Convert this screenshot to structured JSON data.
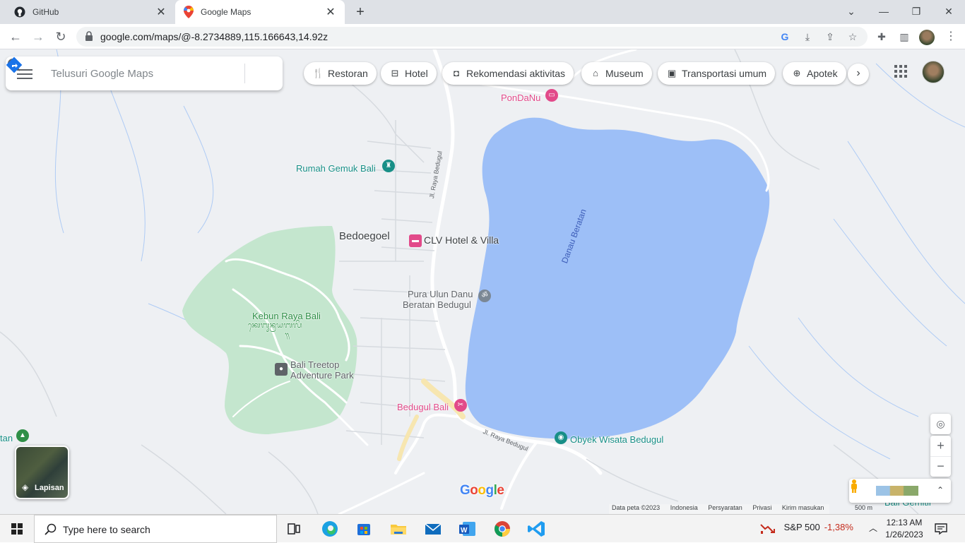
{
  "browser": {
    "tabs": [
      {
        "title": "GitHub",
        "icon": "github-icon",
        "active": false
      },
      {
        "title": "Google Maps",
        "icon": "google-maps-icon",
        "active": true
      }
    ],
    "new_tab_symbol": "+",
    "window_controls": {
      "minimize": "—",
      "restore": "❐",
      "close": "✕",
      "tabs_dropdown": "⌄"
    },
    "url": "google.com/maps/@-8.2734889,115.166643,14.92z"
  },
  "maps": {
    "search": {
      "placeholder": "Telusuri Google Maps"
    },
    "chips": [
      {
        "label": "Restoran",
        "icon": "restaurant-icon"
      },
      {
        "label": "Hotel",
        "icon": "hotel-icon"
      },
      {
        "label": "Rekomendasi aktivitas",
        "icon": "camera-icon"
      },
      {
        "label": "Museum",
        "icon": "museum-icon"
      },
      {
        "label": "Transportasi umum",
        "icon": "transit-icon"
      },
      {
        "label": "Apotek",
        "icon": "pharmacy-icon"
      }
    ],
    "places": {
      "pondanu": "PonDaNu",
      "rumah_gemuk": "Rumah Gemuk Bali",
      "bedoegoel": "Bedoegoel",
      "clv_hotel": "CLV Hotel & Villa",
      "pura_line1": "Pura Ulun Danu",
      "pura_line2": "Beratan Bedugul",
      "kebun_raya": "Kebun Raya Bali",
      "kebun_raya_balinese_line1": "ᬓᬾᬩᬸᬦ᭄ᬭᬬᬩᬮᬶ",
      "kebun_raya_balinese_line2": "᭟",
      "treetop_line1": "Bali Treetop",
      "treetop_line2": "Adventure Park",
      "bedugul_bali": "Bedugul Bali",
      "obyek_wisata": "Obyek Wisata Bedugul",
      "beratan_partial": "tan",
      "gemitir_partial": "Bali Gemitir",
      "danau": "Danau Beratan",
      "road_1": "Jl. Raya Bedugul",
      "road_2": "Jl. Raya Bedugul"
    },
    "layers_label": "Lapisan",
    "zoom_in": "+",
    "zoom_out": "−",
    "logo": {
      "G": "G",
      "o1": "o",
      "o2": "o",
      "g": "g",
      "l": "l",
      "e": "e"
    },
    "attribution": {
      "data": "Data peta ©2023",
      "country": "Indonesia",
      "terms": "Persyaratan",
      "privacy": "Privasi",
      "feedback": "Kirim masukan",
      "scale": "500 m"
    },
    "colors": {
      "water": "#9dbff7",
      "park": "#c4e6ce",
      "land": "#eef0f3",
      "road": "#ffffff",
      "poi_teal": "#188f87",
      "poi_pink": "#e24a8a"
    }
  },
  "taskbar": {
    "search_placeholder": "Type here to search",
    "stock": {
      "name": "S&P 500",
      "change": "-1,38%"
    },
    "time": "12:13 AM",
    "date": "1/26/2023"
  }
}
